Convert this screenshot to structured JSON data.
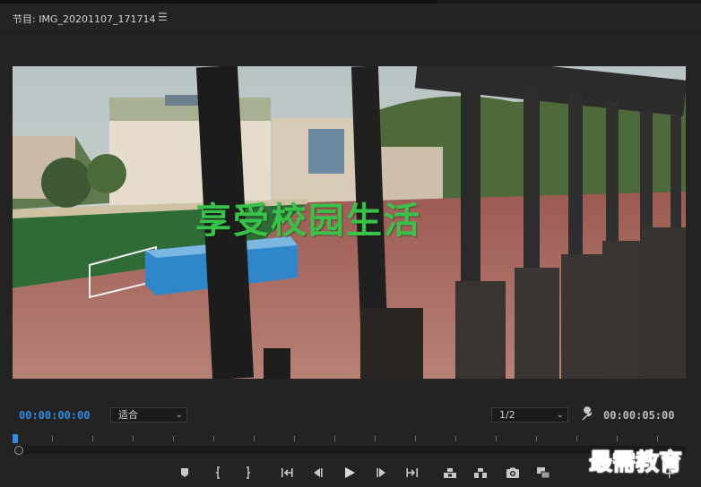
{
  "panel": {
    "title": "节目: IMG_20201107_171714",
    "menu_icon": "hamburger-menu-icon"
  },
  "video": {
    "overlay_text": "享受校园生活"
  },
  "controls": {
    "current_time": "00:00:00:00",
    "fit_value": "适合",
    "resolution_value": "1/2",
    "duration": "00:00:05:00",
    "wrench_icon": "wrench-icon"
  },
  "timeline": {
    "playhead_position": 0.0
  },
  "transport": {
    "buttons": [
      "add-marker-icon",
      "mark-in-icon",
      "mark-out-icon",
      "go-to-in-icon",
      "step-back-icon",
      "play-icon",
      "step-forward-icon",
      "go-to-out-icon",
      "lift-icon",
      "extract-icon",
      "export-frame-icon",
      "compare-view-icon"
    ]
  },
  "watermark": {
    "text": "最需教育"
  },
  "colors": {
    "accent": "#2f8de4",
    "background": "#232323",
    "caption": "#39c24a"
  }
}
